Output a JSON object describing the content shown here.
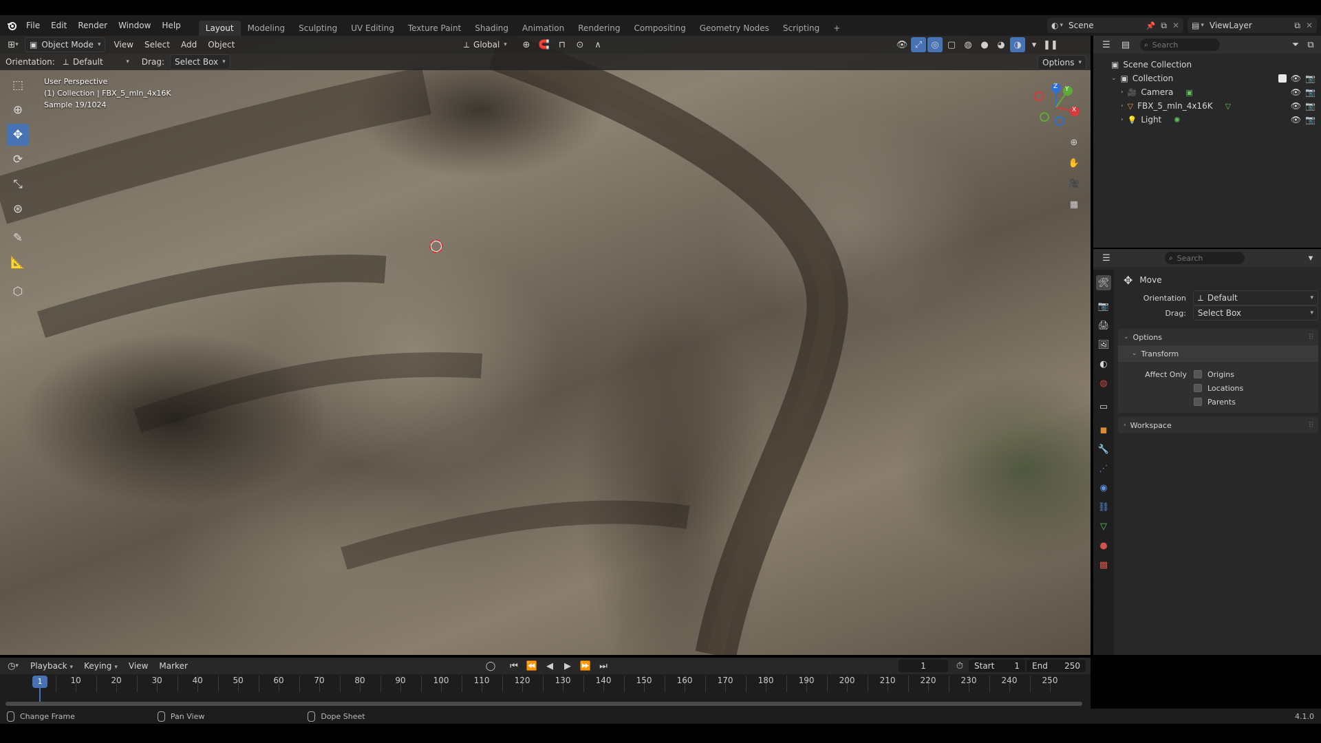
{
  "topbar": {
    "menus": [
      "File",
      "Edit",
      "Render",
      "Window",
      "Help"
    ],
    "workspaces": [
      "Layout",
      "Modeling",
      "Sculpting",
      "UV Editing",
      "Texture Paint",
      "Shading",
      "Animation",
      "Rendering",
      "Compositing",
      "Geometry Nodes",
      "Scripting"
    ],
    "active_workspace": "Layout",
    "add_workspace": "+",
    "scene": "Scene",
    "view_layer": "ViewLayer"
  },
  "viewport_header": {
    "mode": "Object Mode",
    "menus": [
      "View",
      "Select",
      "Add",
      "Object"
    ],
    "transform_orientation": "Global",
    "options_label": "Options"
  },
  "tool_settings": {
    "orientation_label": "Orientation:",
    "orientation_value": "Default",
    "drag_label": "Drag:",
    "drag_value": "Select Box"
  },
  "viewport_info": {
    "line1": "User Perspective",
    "line2": "(1) Collection | FBX_5_mln_4x16K",
    "line3": "Sample 19/1024"
  },
  "gizmo": {
    "x": "X",
    "y": "Y",
    "z": "Z"
  },
  "outliner": {
    "search_placeholder": "Search",
    "scene_collection": "Scene Collection",
    "collection": "Collection",
    "items": [
      {
        "name": "Camera",
        "icon": "camera-icon",
        "color": "#e0a040"
      },
      {
        "name": "FBX_5_mln_4x16K",
        "icon": "mesh-icon",
        "color": "#e0a040"
      },
      {
        "name": "Light",
        "icon": "light-icon",
        "color": "#e0a040"
      }
    ]
  },
  "properties": {
    "search_placeholder": "Search",
    "tool_name": "Move",
    "orientation_label": "Orientation",
    "orientation_value": "Default",
    "drag_label": "Drag:",
    "drag_value": "Select Box",
    "options_panel": "Options",
    "transform_subpanel": "Transform",
    "affect_only_label": "Affect Only",
    "affect_options": [
      {
        "label": "Origins",
        "checked": false
      },
      {
        "label": "Locations",
        "checked": false
      },
      {
        "label": "Parents",
        "checked": false
      }
    ],
    "workspace_panel": "Workspace"
  },
  "timeline": {
    "menus": [
      "Playback",
      "Keying",
      "View",
      "Marker"
    ],
    "current_frame": "1",
    "start_label": "Start",
    "start_value": "1",
    "end_label": "End",
    "end_value": "250",
    "playhead": "1",
    "ruler": [
      "10",
      "20",
      "30",
      "40",
      "50",
      "60",
      "70",
      "80",
      "90",
      "100",
      "110",
      "120",
      "130",
      "140",
      "150",
      "160",
      "170",
      "180",
      "190",
      "200",
      "210",
      "220",
      "230",
      "240",
      "250"
    ]
  },
  "statusbar": {
    "items": [
      "Change Frame",
      "Pan View",
      "Dope Sheet"
    ],
    "version": "4.1.0"
  }
}
